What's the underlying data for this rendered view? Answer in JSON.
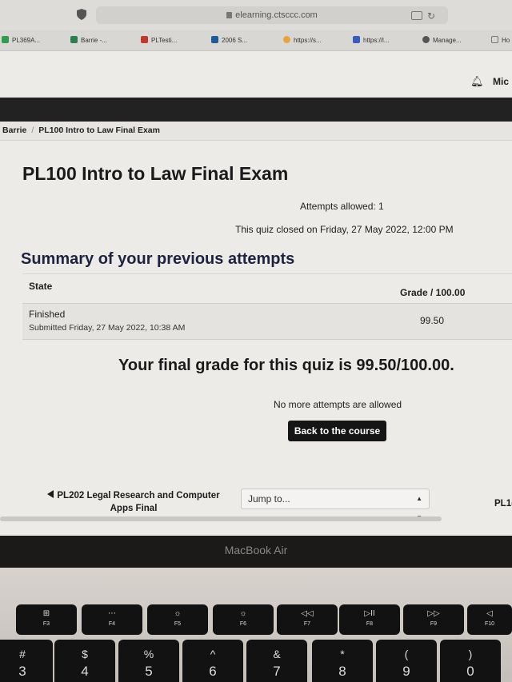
{
  "browser": {
    "address": "elearning.ctsccc.com",
    "tabs": [
      {
        "label": "PL369A...",
        "color": "#2e9b4e"
      },
      {
        "label": "Barrie -...",
        "color": "#2e7d4e"
      },
      {
        "label": "PLTesti...",
        "color": "#c0392b"
      },
      {
        "label": "2006 S...",
        "color": "#1e5a9c"
      },
      {
        "label": "https://s...",
        "color": "#e8a33d"
      },
      {
        "label": "https://l...",
        "color": "#3a5bbf"
      },
      {
        "label": "Manage...",
        "color": "#555555"
      },
      {
        "label": "Ho",
        "color": "#777777"
      }
    ]
  },
  "header": {
    "user_name": "Mic"
  },
  "breadcrumb": {
    "items": [
      "Barrie",
      "PL100 Intro to Law Final Exam"
    ],
    "separator": "/"
  },
  "quiz": {
    "title": "PL100 Intro to Law Final Exam",
    "attempts_allowed": "Attempts allowed: 1",
    "closed_text": "This quiz closed on Friday, 27 May 2022, 12:00 PM",
    "summary_heading": "Summary of your previous attempts",
    "table": {
      "headers": {
        "state": "State",
        "grade": "Grade / 100.00"
      },
      "rows": [
        {
          "state": "Finished",
          "submitted": "Submitted Friday, 27 May 2022, 10:38 AM",
          "grade": "99.50"
        }
      ]
    },
    "final_grade": "Your final grade for this quiz is 99.50/100.00.",
    "no_more_attempts": "No more attempts are allowed",
    "back_button": "Back to the course"
  },
  "navigation": {
    "prev_activity": "PL202 Legal Research and Computer Apps Final",
    "jump_placeholder": "Jump to...",
    "next_activity": "PL1("
  },
  "laptop": {
    "brand": "MacBook Air",
    "function_keys": [
      {
        "symbol": "⊞",
        "label": "F3"
      },
      {
        "symbol": "⋯",
        "label": "F4"
      },
      {
        "symbol": "☼",
        "label": "F5"
      },
      {
        "symbol": "☼",
        "label": "F6"
      },
      {
        "symbol": "◁◁",
        "label": "F7"
      },
      {
        "symbol": "▷II",
        "label": "F8"
      },
      {
        "symbol": "▷▷",
        "label": "F9"
      },
      {
        "symbol": "◁",
        "label": "F10"
      }
    ],
    "number_keys": [
      {
        "top": "#",
        "bottom": "3"
      },
      {
        "top": "$",
        "bottom": "4"
      },
      {
        "top": "%",
        "bottom": "5"
      },
      {
        "top": "^",
        "bottom": "6"
      },
      {
        "top": "&",
        "bottom": "7"
      },
      {
        "top": "*",
        "bottom": "8"
      },
      {
        "top": "(",
        "bottom": "9"
      },
      {
        "top": ")",
        "bottom": "0"
      }
    ]
  }
}
